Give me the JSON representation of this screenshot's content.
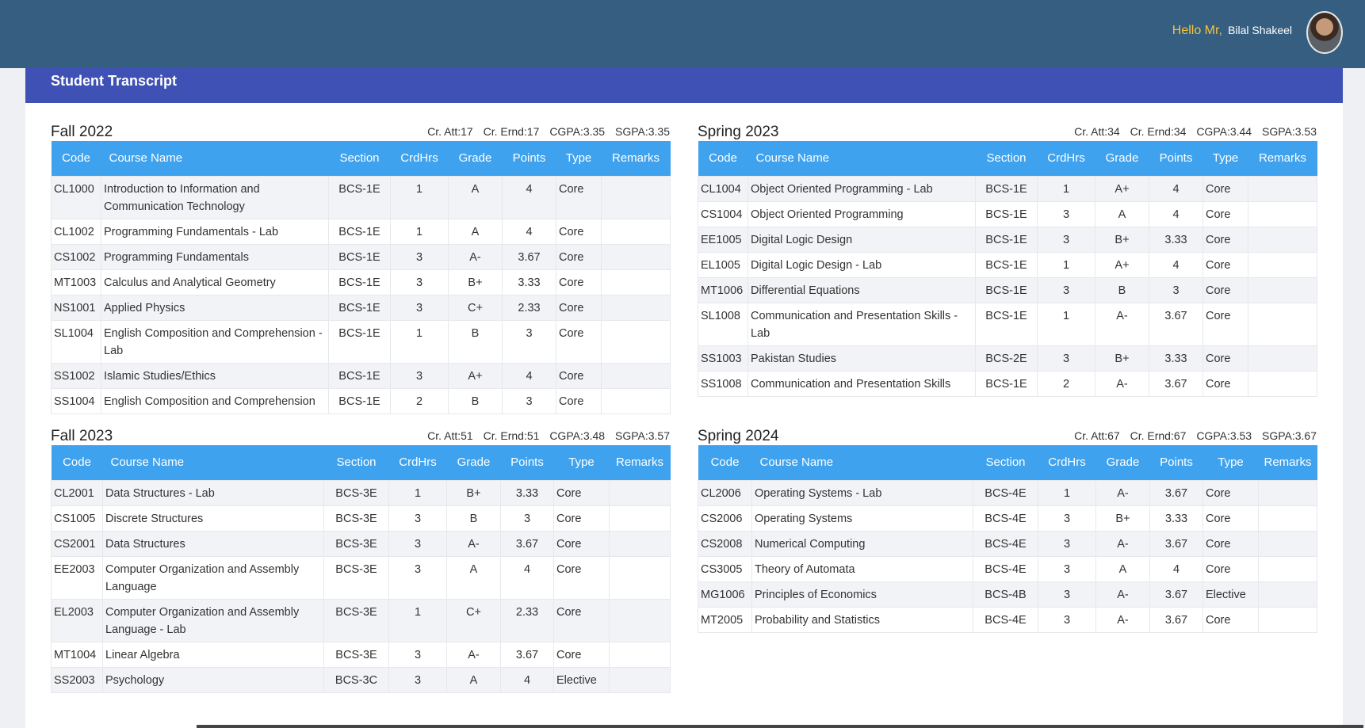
{
  "header": {
    "greeting_prefix": "Hello Mr,",
    "user_name": "Bilal Shakeel"
  },
  "card": {
    "title": "Student Transcript"
  },
  "columns": [
    "Code",
    "Course Name",
    "Section",
    "CrdHrs",
    "Grade",
    "Points",
    "Type",
    "Remarks"
  ],
  "terms": [
    {
      "title": "Fall 2022",
      "cr_att": "Cr. Att:17",
      "cr_ernd": "Cr. Ernd:17",
      "cgpa": "CGPA:3.35",
      "sgpa": "SGPA:3.35",
      "rows": [
        [
          "CL1000",
          "Introduction to Information and Communication Technology",
          "BCS-1E",
          "1",
          "A",
          "4",
          "Core",
          ""
        ],
        [
          "CL1002",
          "Programming Fundamentals - Lab",
          "BCS-1E",
          "1",
          "A",
          "4",
          "Core",
          ""
        ],
        [
          "CS1002",
          "Programming Fundamentals",
          "BCS-1E",
          "3",
          "A-",
          "3.67",
          "Core",
          ""
        ],
        [
          "MT1003",
          "Calculus and Analytical Geometry",
          "BCS-1E",
          "3",
          "B+",
          "3.33",
          "Core",
          ""
        ],
        [
          "NS1001",
          "Applied Physics",
          "BCS-1E",
          "3",
          "C+",
          "2.33",
          "Core",
          ""
        ],
        [
          "SL1004",
          "English Composition and Comprehension - Lab",
          "BCS-1E",
          "1",
          "B",
          "3",
          "Core",
          ""
        ],
        [
          "SS1002",
          "Islamic Studies/Ethics",
          "BCS-1E",
          "3",
          "A+",
          "4",
          "Core",
          ""
        ],
        [
          "SS1004",
          "English Composition and Comprehension",
          "BCS-1E",
          "2",
          "B",
          "3",
          "Core",
          ""
        ]
      ]
    },
    {
      "title": "Spring 2023",
      "cr_att": "Cr. Att:34",
      "cr_ernd": "Cr. Ernd:34",
      "cgpa": "CGPA:3.44",
      "sgpa": "SGPA:3.53",
      "rows": [
        [
          "CL1004",
          "Object Oriented Programming - Lab",
          "BCS-1E",
          "1",
          "A+",
          "4",
          "Core",
          ""
        ],
        [
          "CS1004",
          "Object Oriented Programming",
          "BCS-1E",
          "3",
          "A",
          "4",
          "Core",
          ""
        ],
        [
          "EE1005",
          "Digital Logic Design",
          "BCS-1E",
          "3",
          "B+",
          "3.33",
          "Core",
          ""
        ],
        [
          "EL1005",
          "Digital Logic Design - Lab",
          "BCS-1E",
          "1",
          "A+",
          "4",
          "Core",
          ""
        ],
        [
          "MT1006",
          "Differential Equations",
          "BCS-1E",
          "3",
          "B",
          "3",
          "Core",
          ""
        ],
        [
          "SL1008",
          "Communication and Presentation Skills - Lab",
          "BCS-1E",
          "1",
          "A-",
          "3.67",
          "Core",
          ""
        ],
        [
          "SS1003",
          "Pakistan Studies",
          "BCS-2E",
          "3",
          "B+",
          "3.33",
          "Core",
          ""
        ],
        [
          "SS1008",
          "Communication and Presentation Skills",
          "BCS-1E",
          "2",
          "A-",
          "3.67",
          "Core",
          ""
        ]
      ]
    },
    {
      "title": "Fall 2023",
      "cr_att": "Cr. Att:51",
      "cr_ernd": "Cr. Ernd:51",
      "cgpa": "CGPA:3.48",
      "sgpa": "SGPA:3.57",
      "rows": [
        [
          "CL2001",
          "Data Structures - Lab",
          "BCS-3E",
          "1",
          "B+",
          "3.33",
          "Core",
          ""
        ],
        [
          "CS1005",
          "Discrete Structures",
          "BCS-3E",
          "3",
          "B",
          "3",
          "Core",
          ""
        ],
        [
          "CS2001",
          "Data Structures",
          "BCS-3E",
          "3",
          "A-",
          "3.67",
          "Core",
          ""
        ],
        [
          "EE2003",
          "Computer Organization and Assembly Language",
          "BCS-3E",
          "3",
          "A",
          "4",
          "Core",
          ""
        ],
        [
          "EL2003",
          "Computer Organization and Assembly Language - Lab",
          "BCS-3E",
          "1",
          "C+",
          "2.33",
          "Core",
          ""
        ],
        [
          "MT1004",
          "Linear Algebra",
          "BCS-3E",
          "3",
          "A-",
          "3.67",
          "Core",
          ""
        ],
        [
          "SS2003",
          "Psychology",
          "BCS-3C",
          "3",
          "A",
          "4",
          "Elective",
          ""
        ]
      ]
    },
    {
      "title": "Spring 2024",
      "cr_att": "Cr. Att:67",
      "cr_ernd": "Cr. Ernd:67",
      "cgpa": "CGPA:3.53",
      "sgpa": "SGPA:3.67",
      "rows": [
        [
          "CL2006",
          "Operating Systems - Lab",
          "BCS-4E",
          "1",
          "A-",
          "3.67",
          "Core",
          ""
        ],
        [
          "CS2006",
          "Operating Systems",
          "BCS-4E",
          "3",
          "B+",
          "3.33",
          "Core",
          ""
        ],
        [
          "CS2008",
          "Numerical Computing",
          "BCS-4E",
          "3",
          "A-",
          "3.67",
          "Core",
          ""
        ],
        [
          "CS3005",
          "Theory of Automata",
          "BCS-4E",
          "3",
          "A",
          "4",
          "Core",
          ""
        ],
        [
          "MG1006",
          "Principles of Economics",
          "BCS-4B",
          "3",
          "A-",
          "3.67",
          "Elective",
          ""
        ],
        [
          "MT2005",
          "Probability and Statistics",
          "BCS-4E",
          "3",
          "A-",
          "3.67",
          "Core",
          ""
        ]
      ]
    }
  ]
}
